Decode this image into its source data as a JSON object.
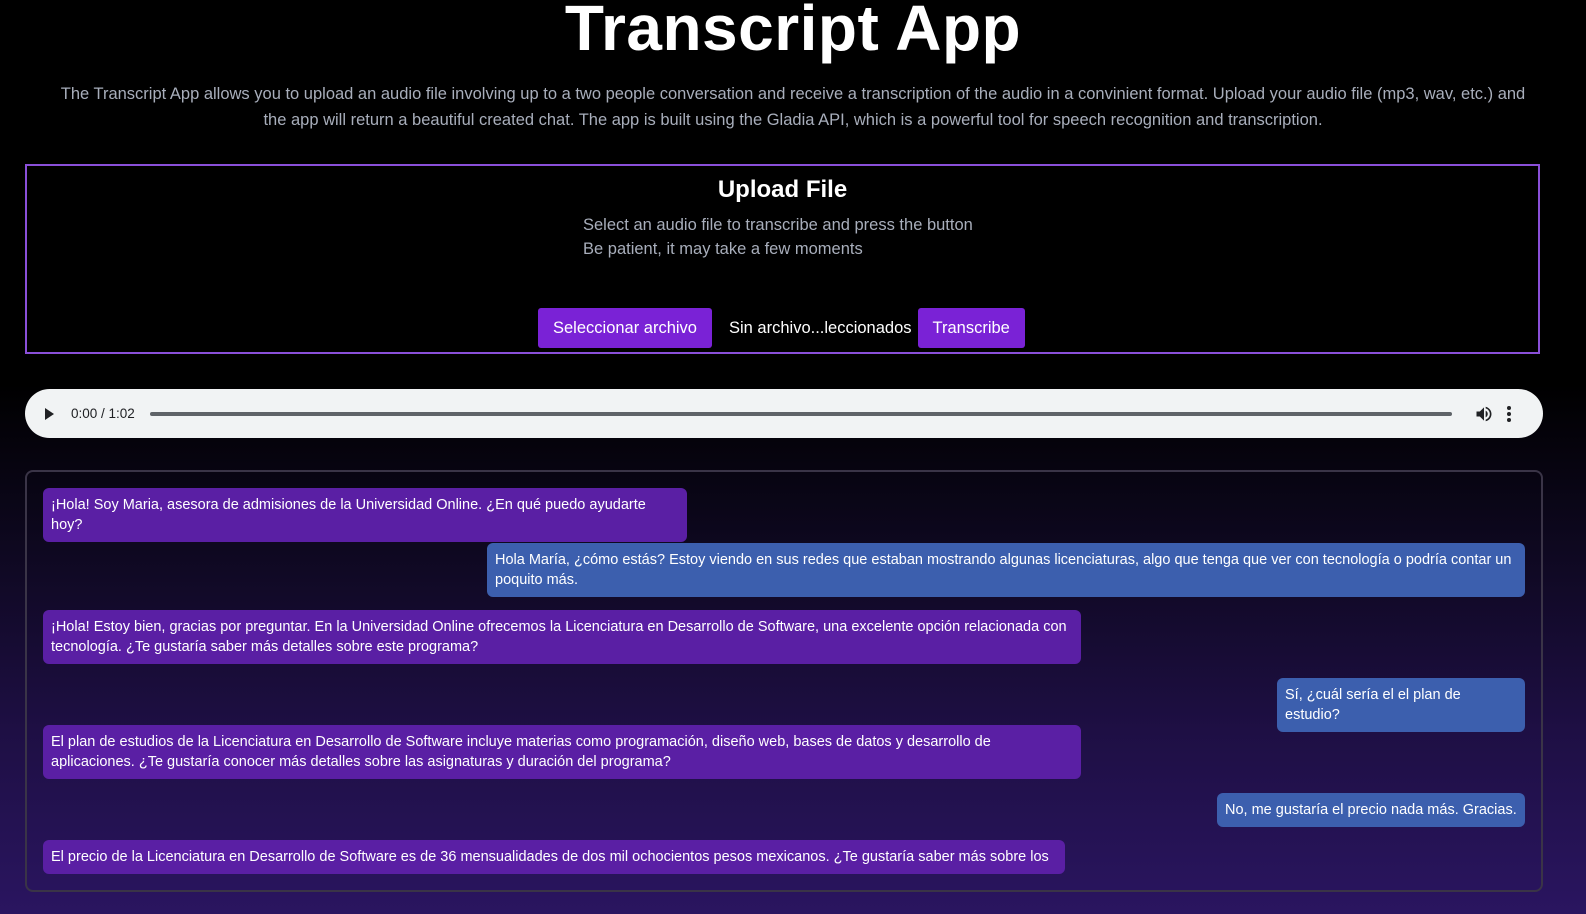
{
  "app": {
    "title": "Transcript App",
    "description": "The Transcript App allows you to upload an audio file involving up to a two people conversation and receive a transcription of the audio in a convinient format. Upload your audio file (mp3, wav, etc.) and the app will return a beautiful created chat. The app is built using the Gladia API, which is a powerful tool for speech recognition and transcription."
  },
  "upload": {
    "title": "Upload File",
    "hint_line1": "Select an audio file to transcribe and press the button",
    "hint_line2": "Be patient, it may take a few moments",
    "select_button": "Seleccionar archivo",
    "file_status": "Sin archivo...leccionados",
    "transcribe_button": "Transcribe"
  },
  "player": {
    "time": "0:00 / 1:02",
    "progress": 0,
    "play_icon": "play-icon",
    "volume_icon": "volume-icon",
    "more_icon": "more-vertical-icon"
  },
  "chat": {
    "messages": [
      {
        "side": "left",
        "text": "¡Hola! Soy Maria, asesora de admisiones de la Universidad Online. ¿En qué puedo ayudarte hoy?"
      },
      {
        "side": "right",
        "text": "Hola María, ¿cómo estás? Estoy viendo en sus redes que estaban mostrando algunas licenciaturas, algo que tenga que ver con tecnología o podría contar un poquito más."
      },
      {
        "side": "left",
        "text": "¡Hola! Estoy bien, gracias por preguntar. En la Universidad Online ofrecemos la Licenciatura en Desarrollo de Software, una excelente opción relacionada con tecnología. ¿Te gustaría saber más detalles sobre este programa?"
      },
      {
        "side": "right",
        "text": "Sí, ¿cuál sería el el plan de estudio?"
      },
      {
        "side": "left",
        "text": "El plan de estudios de la Licenciatura en Desarrollo de Software incluye materias como programación, diseño web, bases de datos y desarrollo de aplicaciones. ¿Te gustaría conocer más detalles sobre las asignaturas y duración del programa?"
      },
      {
        "side": "right",
        "text": "No, me gustaría el precio nada más. Gracias."
      },
      {
        "side": "left",
        "text": "El precio de la Licenciatura en Desarrollo de Software es de 36 mensualidades de dos mil ochocientos pesos mexicanos. ¿Te gustaría saber más sobre los"
      }
    ]
  },
  "colors": {
    "accent": "#7a22d6",
    "assistant_bubble": "#5a1fa4",
    "user_bubble": "#3c5fae"
  }
}
